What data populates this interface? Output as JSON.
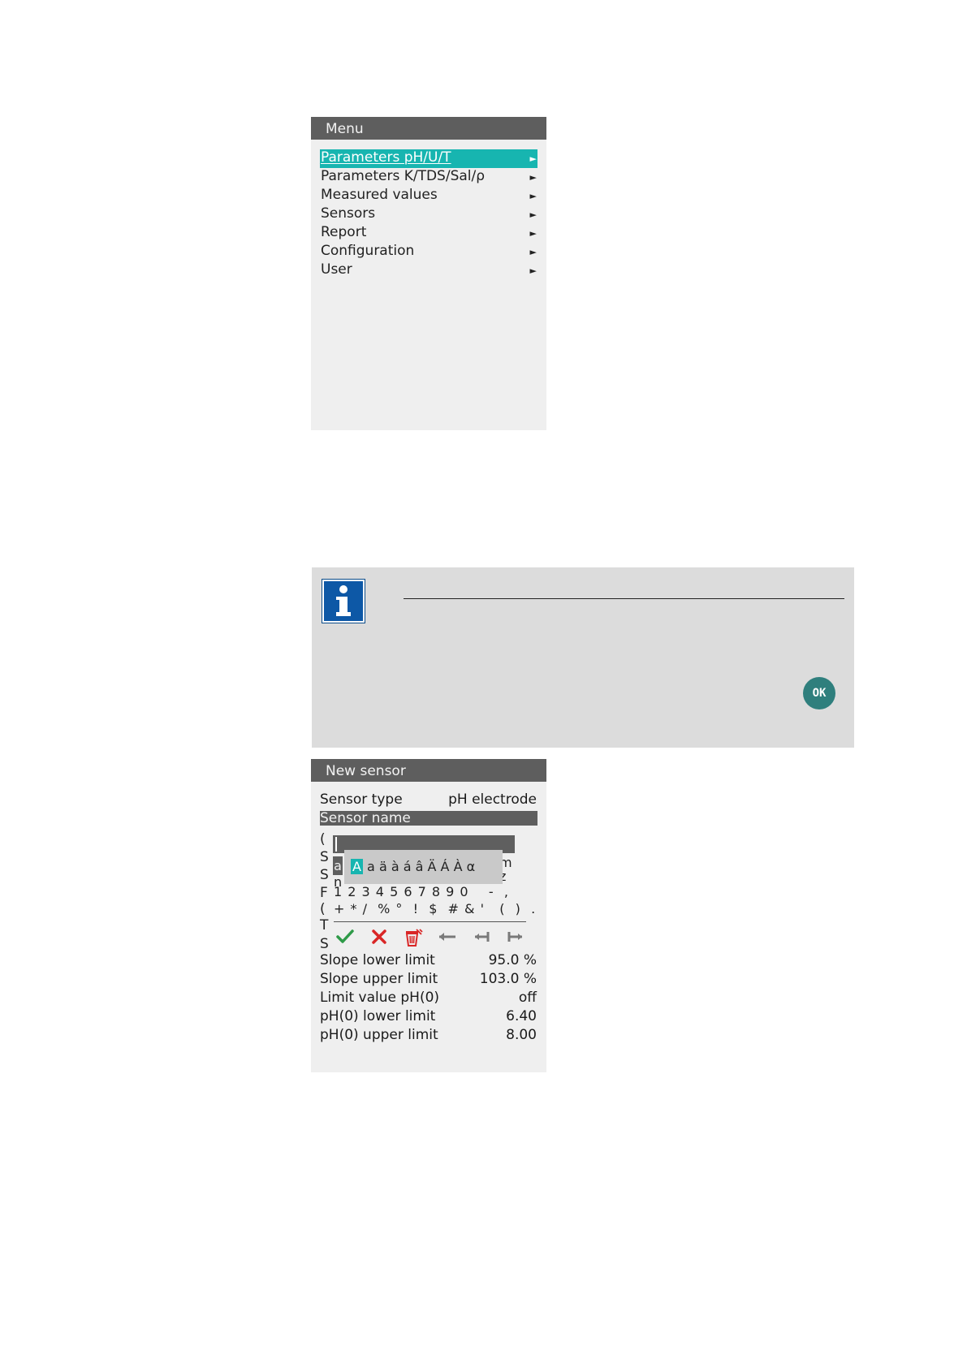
{
  "menu": {
    "title": "Menu",
    "arrow_glyph": "►",
    "items": [
      {
        "label": "Parameters pH/U/T"
      },
      {
        "label": "Parameters K/TDS/Sal/ρ"
      },
      {
        "label": "Measured values"
      },
      {
        "label": "Sensors"
      },
      {
        "label": "Report"
      },
      {
        "label": "Configuration"
      },
      {
        "label": "User"
      }
    ]
  },
  "info_box": {
    "icon": "info-icon",
    "ok_label": "OK"
  },
  "new_sensor": {
    "title": "New sensor",
    "sensor_type_label": "Sensor type",
    "sensor_type_value": "pH electrode",
    "sensor_name_label": "Sensor name",
    "peek_left": [
      "(",
      "S",
      "S",
      "F",
      "(",
      "T",
      "S"
    ],
    "peek_right_m": "m",
    "peek_right_z": "z",
    "peek_right_n": "n",
    "entry": {
      "alpha_row_glyph": "a",
      "accent_chars": "A a ä à á â Ä Á À α",
      "accent_selected": "A",
      "accent_rest": "a ä à á â Ä Á À α",
      "digits_line": "1 2 3 4 5 6 7 8 9 0    -  ,",
      "symbols_line": "+ * /  % °  !  $  # & '   (  )  ."
    },
    "tools": [
      {
        "name": "confirm-icon"
      },
      {
        "name": "cancel-icon"
      },
      {
        "name": "delete-icon"
      },
      {
        "name": "backspace-icon"
      },
      {
        "name": "cursor-left-icon"
      },
      {
        "name": "cursor-right-icon"
      }
    ],
    "rows": [
      {
        "label": "Slope lower limit",
        "value": "95.0 %"
      },
      {
        "label": "Slope upper limit",
        "value": "103.0 %"
      },
      {
        "label": "Limit value pH(0)",
        "value": "off"
      },
      {
        "label": "pH(0) lower limit",
        "value": "6.40"
      },
      {
        "label": "pH(0) upper limit",
        "value": "8.00"
      }
    ]
  }
}
